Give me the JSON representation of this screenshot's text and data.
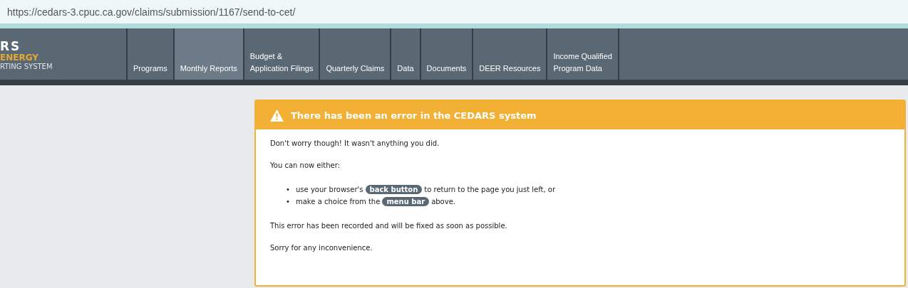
{
  "address_bar": {
    "url": "https://cedars-3.cpuc.ca.gov/claims/submission/1167/send-to-cet/"
  },
  "logo": {
    "line_1": "RS",
    "line_2": "ENERGY",
    "line_3": "RTING SYSTEM"
  },
  "menu": [
    {
      "label": "Programs",
      "selected": false
    },
    {
      "label": "Monthly Reports",
      "selected": true
    },
    {
      "label": "Budget &\nApplication Filings",
      "selected": false
    },
    {
      "label": "Quarterly Claims",
      "selected": false
    },
    {
      "label": "Data",
      "selected": false
    },
    {
      "label": "Documents",
      "selected": false
    },
    {
      "label": "DEER Resources",
      "selected": false
    },
    {
      "label": "Income Qualified\nProgram Data",
      "selected": false
    }
  ],
  "error_card": {
    "title": "There has been an error in the CEDARS system",
    "intro": "Don't worry though! It wasn't anything you did.",
    "lead": "You can now either:",
    "options": [
      {
        "bullet": "•",
        "before": "use your browser's",
        "badge": "back button",
        "after": "to return to the page you just left, or"
      },
      {
        "bullet": "•",
        "before": "make a choice from the",
        "badge": "menu bar",
        "after": "above."
      }
    ],
    "recorded": "This error has been recorded and will be fixed as soon as possible.",
    "apology": "Sorry for any inconvenience."
  }
}
